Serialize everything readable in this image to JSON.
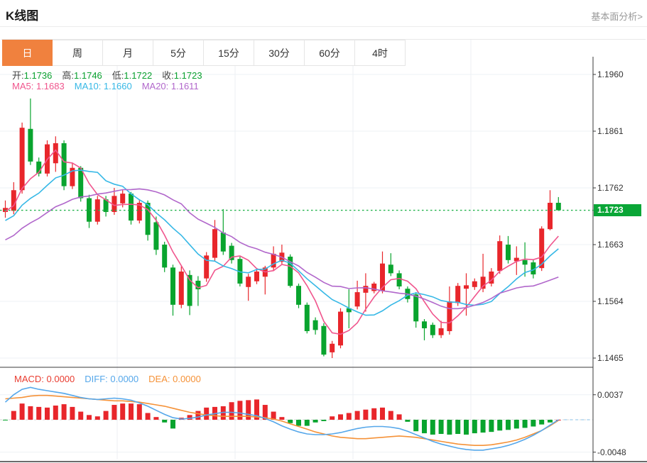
{
  "header": {
    "title": "K线图",
    "link": "基本面分析>"
  },
  "tabs": {
    "items": [
      "日",
      "周",
      "月",
      "5分",
      "15分",
      "30分",
      "60分",
      "4时"
    ],
    "active_index": 0
  },
  "legend": {
    "ohlc": [
      {
        "label": "开:",
        "value": "1.1736"
      },
      {
        "label": "高:",
        "value": "1.1746"
      },
      {
        "label": "低:",
        "value": "1.1722"
      },
      {
        "label": "收:",
        "value": "1.1723"
      }
    ],
    "ohlc_value_color": "#0aa12f",
    "ma": [
      {
        "label": "MA5: ",
        "value": "1.1683",
        "color": "#f0558d"
      },
      {
        "label": "MA10: ",
        "value": "1.1660",
        "color": "#36b8e6"
      },
      {
        "label": "MA20: ",
        "value": "1.1611",
        "color": "#b167cb"
      }
    ]
  },
  "macd_legend": [
    {
      "label": "MACD: ",
      "value": "0.0000",
      "color": "#e93c30"
    },
    {
      "label": "DIFF: ",
      "value": "0.0000",
      "color": "#55a7ea"
    },
    {
      "label": "DEA: ",
      "value": "0.0000",
      "color": "#f59238"
    }
  ],
  "colors": {
    "up": "#e8262b",
    "down": "#09a42e",
    "ma5": "#f0558d",
    "ma10": "#36b8e6",
    "ma20": "#b167cb",
    "diff": "#55a7ea",
    "dea": "#f59238",
    "price_line": "#21b24b",
    "tag_bg": "#0aa637",
    "grid": "#edf1f6",
    "vgrid": "#eceff3",
    "axis": "#3a3a3a",
    "zero_dash": "#d6d6d6",
    "zero_dash_blue": "#aed6f1"
  },
  "chart_data": {
    "type": "candlestick",
    "title": "K线图",
    "panels": [
      "price",
      "macd"
    ],
    "price_axis": {
      "tick_labels": [
        "1.1960",
        "1.1861",
        "1.1762",
        "1.1663",
        "1.1564",
        "1.1465"
      ],
      "tick_values": [
        1.196,
        1.1861,
        1.1762,
        1.1663,
        1.1564,
        1.1465
      ],
      "last_price": 1.1723,
      "last_price_label": "1.1723"
    },
    "macd_axis": {
      "tick_labels": [
        "0.0037",
        "-0.0048"
      ],
      "tick_values": [
        0.0037,
        -0.0048
      ]
    },
    "ma_periods": [
      5,
      10,
      20
    ],
    "ma_preseed": {
      "from": 1.16,
      "to": 1.173,
      "count": 20
    },
    "candles": [
      [
        1.172,
        1.174,
        1.171,
        1.1727
      ],
      [
        1.1722,
        1.1772,
        1.1716,
        1.1758
      ],
      [
        1.1758,
        1.1876,
        1.1752,
        1.1867
      ],
      [
        1.1865,
        1.1918,
        1.1802,
        1.1808
      ],
      [
        1.1808,
        1.1815,
        1.1782,
        1.1787
      ],
      [
        1.1787,
        1.1845,
        1.1782,
        1.1838
      ],
      [
        1.1805,
        1.1852,
        1.179,
        1.184
      ],
      [
        1.184,
        1.1845,
        1.1758,
        1.1765
      ],
      [
        1.1765,
        1.1805,
        1.176,
        1.1797
      ],
      [
        1.1797,
        1.18,
        1.1738,
        1.1744
      ],
      [
        1.1744,
        1.175,
        1.1692,
        1.1703
      ],
      [
        1.1703,
        1.1748,
        1.1698,
        1.1742
      ],
      [
        1.1742,
        1.1748,
        1.1712,
        1.172
      ],
      [
        1.172,
        1.1762,
        1.1715,
        1.1748
      ],
      [
        1.1735,
        1.1758,
        1.1728,
        1.1752
      ],
      [
        1.1752,
        1.1755,
        1.1698,
        1.1705
      ],
      [
        1.1705,
        1.1742,
        1.17,
        1.1736
      ],
      [
        1.1736,
        1.174,
        1.167,
        1.168
      ],
      [
        1.1702,
        1.1712,
        1.1645,
        1.1654
      ],
      [
        1.1663,
        1.1668,
        1.1615,
        1.1623
      ],
      [
        1.1623,
        1.1628,
        1.1539,
        1.1558
      ],
      [
        1.1558,
        1.1625,
        1.1552,
        1.1616
      ],
      [
        1.161,
        1.1618,
        1.154,
        1.1556
      ],
      [
        1.16,
        1.1608,
        1.1556,
        1.1585
      ],
      [
        1.1604,
        1.165,
        1.1598,
        1.1644
      ],
      [
        1.164,
        1.1706,
        1.1634,
        1.169
      ],
      [
        1.1684,
        1.1725,
        1.1645,
        1.1651
      ],
      [
        1.1661,
        1.1666,
        1.163,
        1.1636
      ],
      [
        1.1638,
        1.1642,
        1.159,
        1.1595
      ],
      [
        1.1589,
        1.1612,
        1.1565,
        1.1607
      ],
      [
        1.1599,
        1.162,
        1.1594,
        1.1616
      ],
      [
        1.1607,
        1.1626,
        1.1576,
        1.1623
      ],
      [
        1.1623,
        1.166,
        1.1618,
        1.1647
      ],
      [
        1.1633,
        1.1663,
        1.1628,
        1.1649
      ],
      [
        1.1642,
        1.1646,
        1.1588,
        1.1591
      ],
      [
        1.1591,
        1.1595,
        1.1552,
        1.1558
      ],
      [
        1.1558,
        1.1562,
        1.1508,
        1.1512
      ],
      [
        1.1531,
        1.1536,
        1.1506,
        1.1514
      ],
      [
        1.1521,
        1.1526,
        1.1468,
        1.1471
      ],
      [
        1.1475,
        1.1495,
        1.1465,
        1.149
      ],
      [
        1.1487,
        1.1552,
        1.1482,
        1.1546
      ],
      [
        1.1552,
        1.1585,
        1.1517,
        1.1545
      ],
      [
        1.1555,
        1.16,
        1.155,
        1.158
      ],
      [
        1.1579,
        1.1613,
        1.1546,
        1.1591
      ],
      [
        1.1582,
        1.1598,
        1.1578,
        1.1595
      ],
      [
        1.1582,
        1.1651,
        1.1578,
        1.163
      ],
      [
        1.1628,
        1.1648,
        1.1608,
        1.1613
      ],
      [
        1.1613,
        1.1618,
        1.1585,
        1.159
      ],
      [
        1.1586,
        1.159,
        1.1562,
        1.1568
      ],
      [
        1.1576,
        1.158,
        1.1518,
        1.1529
      ],
      [
        1.1529,
        1.1533,
        1.1496,
        1.1517
      ],
      [
        1.1523,
        1.1527,
        1.15,
        1.1505
      ],
      [
        1.1505,
        1.153,
        1.15,
        1.1517
      ],
      [
        1.1512,
        1.159,
        1.1506,
        1.1564
      ],
      [
        1.1561,
        1.1596,
        1.1556,
        1.1591
      ],
      [
        1.1586,
        1.1613,
        1.1539,
        1.1592
      ],
      [
        1.1589,
        1.1604,
        1.1584,
        1.1599
      ],
      [
        1.1586,
        1.1647,
        1.158,
        1.1607
      ],
      [
        1.1595,
        1.1622,
        1.159,
        1.1616
      ],
      [
        1.1617,
        1.1679,
        1.1612,
        1.1669
      ],
      [
        1.1663,
        1.1678,
        1.163,
        1.1636
      ],
      [
        1.1634,
        1.166,
        1.161,
        1.164
      ],
      [
        1.1636,
        1.1667,
        1.1607,
        1.1628
      ],
      [
        1.1632,
        1.1636,
        1.1604,
        1.1611
      ],
      [
        1.1622,
        1.1695,
        1.1617,
        1.1691
      ],
      [
        1.169,
        1.1758,
        1.1688,
        1.1736
      ],
      [
        1.1736,
        1.1746,
        1.1722,
        1.1723
      ]
    ],
    "macd_bars": [
      -0.0001,
      0.0013,
      0.0024,
      0.002,
      0.0019,
      0.0018,
      0.0021,
      0.0023,
      0.0019,
      0.0012,
      0.0007,
      0.0005,
      0.0013,
      0.0022,
      0.0024,
      0.0024,
      0.0023,
      0.001,
      0.0004,
      -0.0004,
      -0.0013,
      0.0003,
      0.0007,
      0.0013,
      0.0018,
      0.0019,
      0.002,
      0.0026,
      0.0028,
      0.0029,
      0.003,
      0.0022,
      0.0012,
      0.0004,
      -0.0005,
      -0.0009,
      -0.0009,
      -0.0004,
      -0.0002,
      0.0005,
      0.0008,
      0.001,
      0.0013,
      0.0015,
      0.0017,
      0.0018,
      0.0013,
      0.0008,
      -0.0003,
      -0.0017,
      -0.002,
      -0.0022,
      -0.0021,
      -0.0022,
      -0.0021,
      -0.0022,
      -0.002,
      -0.0019,
      -0.0018,
      -0.0016,
      -0.0015,
      -0.0013,
      -0.0012,
      -0.001,
      -0.0007,
      -0.0004,
      0.0
    ],
    "diff": [
      0.0026,
      0.0037,
      0.0045,
      0.0048,
      0.0045,
      0.0043,
      0.0041,
      0.0039,
      0.0036,
      0.0033,
      0.0031,
      0.003,
      0.0031,
      0.0032,
      0.0031,
      0.0029,
      0.0025,
      0.002,
      0.0014,
      0.0008,
      0.0003,
      0.0001,
      0.0002,
      0.0004,
      0.0007,
      0.0009,
      0.0011,
      0.0011,
      0.001,
      0.0008,
      0.0006,
      0.0002,
      -0.0003,
      -0.0009,
      -0.0014,
      -0.0018,
      -0.0021,
      -0.0022,
      -0.0022,
      -0.0021,
      -0.0019,
      -0.0016,
      -0.0013,
      -0.0011,
      -0.001,
      -0.001,
      -0.0011,
      -0.0013,
      -0.0017,
      -0.0022,
      -0.0027,
      -0.0032,
      -0.0036,
      -0.0039,
      -0.0042,
      -0.0044,
      -0.0045,
      -0.0045,
      -0.0043,
      -0.0041,
      -0.0038,
      -0.0034,
      -0.0029,
      -0.0023,
      -0.0016,
      -0.0008,
      0.0
    ],
    "dea": [
      0.0031,
      0.0032,
      0.0033,
      0.0035,
      0.0036,
      0.0036,
      0.0035,
      0.0034,
      0.0033,
      0.0032,
      0.0031,
      0.003,
      0.0029,
      0.0028,
      0.0028,
      0.0027,
      0.0026,
      0.0024,
      0.0022,
      0.002,
      0.0017,
      0.0014,
      0.0011,
      0.0009,
      0.0007,
      0.0006,
      0.0005,
      0.0005,
      0.0005,
      0.0005,
      0.0004,
      0.0003,
      0.0001,
      -0.0002,
      -0.0006,
      -0.001,
      -0.0014,
      -0.0018,
      -0.0021,
      -0.0024,
      -0.0026,
      -0.0027,
      -0.0028,
      -0.0028,
      -0.0027,
      -0.0026,
      -0.0025,
      -0.0024,
      -0.0025,
      -0.0026,
      -0.0028,
      -0.003,
      -0.0032,
      -0.0034,
      -0.0036,
      -0.0037,
      -0.0038,
      -0.0038,
      -0.0037,
      -0.0035,
      -0.0033,
      -0.003,
      -0.0026,
      -0.0021,
      -0.0016,
      -0.0009,
      -0.0001
    ]
  }
}
